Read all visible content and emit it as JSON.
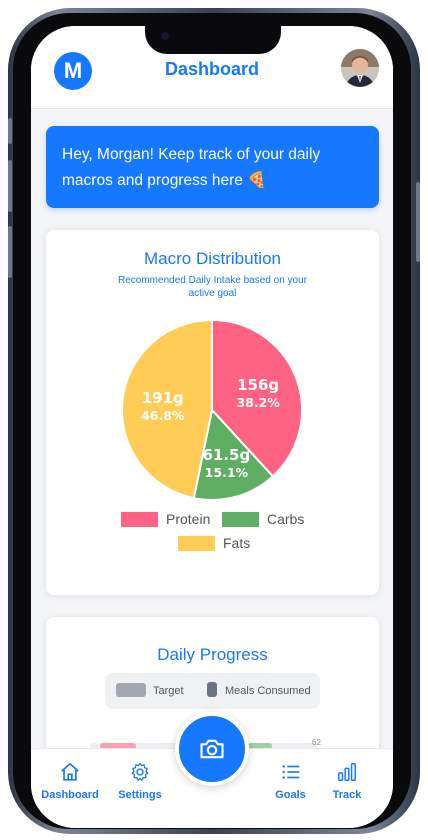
{
  "header": {
    "logo_letter": "M",
    "title": "Dashboard"
  },
  "banner": {
    "text": "Hey, Morgan! Keep track of your daily macros and progress here 🍕"
  },
  "macro_card": {
    "title": "Macro Distribution",
    "subtitle": "Recommended Daily Intake based on your active goal"
  },
  "chart_data": {
    "type": "pie",
    "title": "Macro Distribution",
    "subtitle": "Recommended Daily Intake based on your active goal",
    "legend_position": "bottom",
    "slices": [
      {
        "name": "Protein",
        "value": 156,
        "label": "156g",
        "percent": "38.2%",
        "color": "#ff6384"
      },
      {
        "name": "Carbs",
        "value": 61.5,
        "label": "61.5g",
        "percent": "15.1%",
        "color": "#5fae64"
      },
      {
        "name": "Fats",
        "value": 191,
        "label": "191g",
        "percent": "46.8%",
        "color": "#ffcd56"
      }
    ]
  },
  "progress_card": {
    "title": "Daily Progress",
    "legend": [
      {
        "label": "Target",
        "color": "#a3a8b0"
      },
      {
        "label": "Meals Consumed",
        "color": "#6b7280"
      }
    ],
    "axis_label": "62"
  },
  "nav": {
    "items": [
      {
        "label": "Dashboard",
        "icon": "home-icon"
      },
      {
        "label": "Settings",
        "icon": "gear-icon"
      },
      {
        "label": "Goals",
        "icon": "list-icon"
      },
      {
        "label": "Track",
        "icon": "bar-chart-icon"
      }
    ],
    "fab_icon": "camera-icon"
  },
  "colors": {
    "accent": "#1677ff",
    "protein": "#ff6384",
    "carbs": "#5fae64",
    "fats": "#ffcd56"
  }
}
